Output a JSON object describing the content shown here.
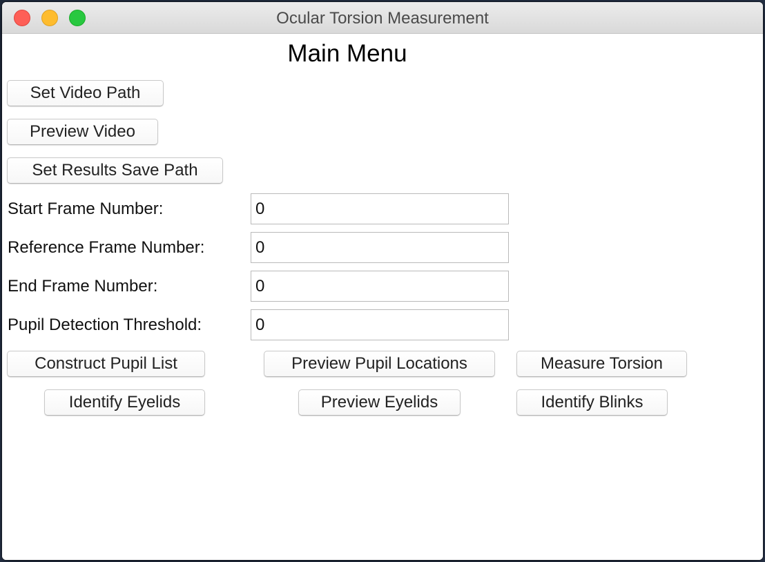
{
  "window": {
    "title": "Ocular Torsion Measurement"
  },
  "main": {
    "title": "Main Menu",
    "buttons": {
      "set_video_path": "Set Video Path",
      "preview_video": "Preview Video",
      "set_results_save_path": "Set Results Save Path",
      "construct_pupil_list": "Construct Pupil List",
      "preview_pupil_locations": "Preview Pupil Locations",
      "measure_torsion": "Measure Torsion",
      "identify_eyelids": "Identify Eyelids",
      "preview_eyelids": "Preview Eyelids",
      "identify_blinks": "Identify Blinks"
    },
    "fields": {
      "start_frame": {
        "label": "Start Frame Number:",
        "value": "0"
      },
      "reference_frame": {
        "label": "Reference Frame Number:",
        "value": "0"
      },
      "end_frame": {
        "label": "End Frame Number:",
        "value": "0"
      },
      "pupil_threshold": {
        "label": "Pupil Detection Threshold:",
        "value": "0"
      }
    }
  },
  "colors": {
    "close": "#fe5f57",
    "minimize": "#febc2e",
    "maximize": "#28c840"
  }
}
